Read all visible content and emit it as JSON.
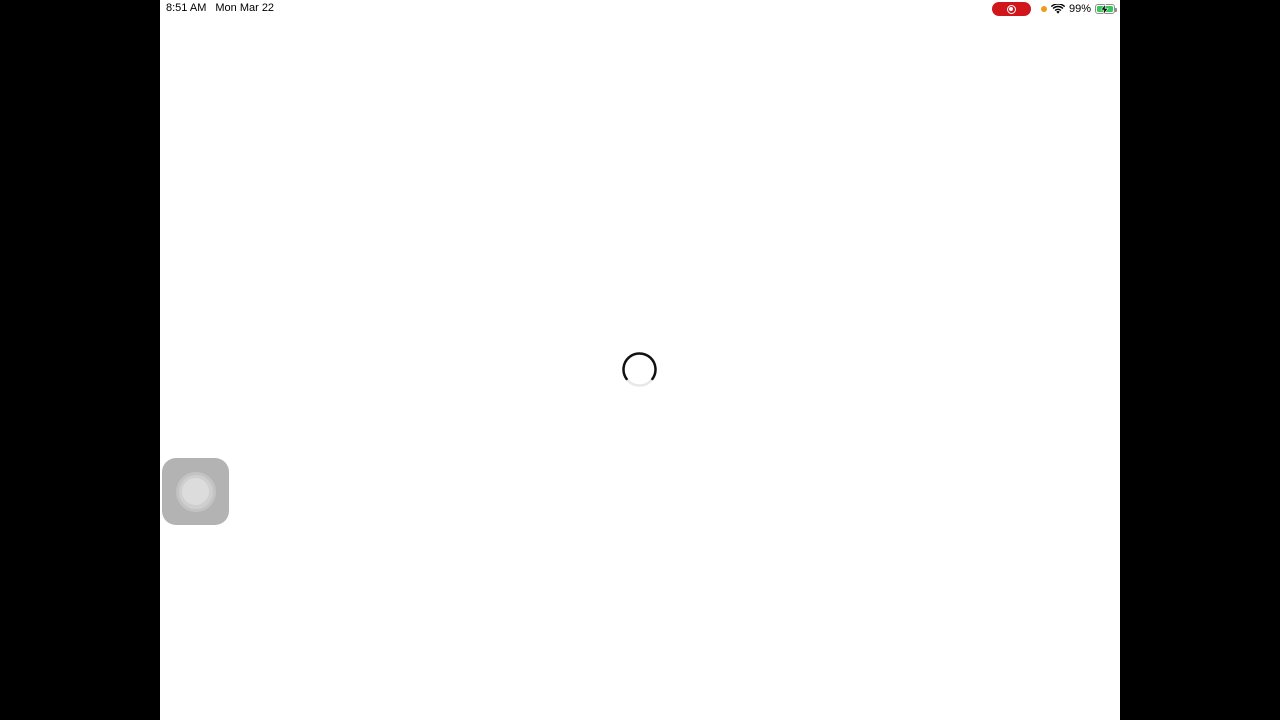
{
  "status_bar": {
    "time": "8:51 AM",
    "date": "Mon Mar 22",
    "battery_percent_label": "99%",
    "battery_level": 0.99,
    "screen_recording_color": "#d0161b",
    "privacy_indicator_color": "#f09a1a",
    "battery_fill_color": "#34c759",
    "icons": [
      "screen-record-icon",
      "wifi-icon",
      "battery-charging-icon"
    ]
  },
  "main": {
    "state": "loading",
    "spinner_icon": "loading-spinner-icon"
  },
  "assistive_touch": {
    "icon": "assistive-touch-icon"
  },
  "colors": {
    "screen_background": "#ffffff",
    "letterbox": "#000000"
  }
}
